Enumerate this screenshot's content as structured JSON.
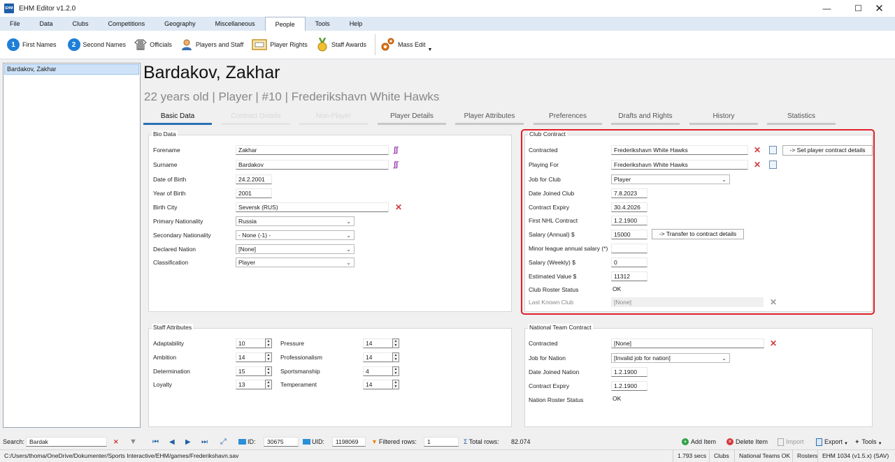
{
  "window": {
    "title": "EHM Editor v1.2.0",
    "app_icon_text": "EHM"
  },
  "menu": [
    "File",
    "Data",
    "Clubs",
    "Competitions",
    "Geography",
    "Miscellaneous",
    "People",
    "Tools",
    "Help"
  ],
  "menu_active": "People",
  "toolbar": {
    "first_names": "First Names",
    "first_names_num": "1",
    "second_names": "Second Names",
    "second_names_num": "2",
    "officials": "Officials",
    "players_staff": "Players and Staff",
    "player_rights": "Player Rights",
    "staff_awards": "Staff Awards",
    "mass_edit": "Mass Edit"
  },
  "list": {
    "items": [
      "Bardakov, Zakhar"
    ]
  },
  "player": {
    "name": "Bardakov, Zakhar",
    "subtitle": "22 years old | Player | #10 | Frederikshavn White Hawks"
  },
  "tabs": [
    "Basic Data",
    "Contract Details",
    "Non-Player",
    "Player Details",
    "Player Attributes",
    "Preferences",
    "Drafts and Rights",
    "History",
    "Statistics"
  ],
  "bio": {
    "title": "Bio Data",
    "forename_label": "Forename",
    "forename": "Zakhar",
    "surname_label": "Surname",
    "surname": "Bardakov",
    "dob_label": "Date of Birth",
    "dob": "24.2.2001",
    "yob_label": "Year of Birth",
    "yob": "2001",
    "city_label": "Birth City",
    "city": "Seversk (RUS)",
    "primary_nat_label": "Primary Nationality",
    "primary_nat": "Russia",
    "secondary_nat_label": "Secondary Nationality",
    "secondary_nat": "- None (-1) -",
    "declared_label": "Declared Nation",
    "declared": "[None]",
    "class_label": "Classification",
    "class": "Player"
  },
  "club_contract": {
    "title": "Club Contract",
    "contracted_label": "Contracted",
    "contracted": "Frederikshavn White Hawks",
    "set_details_btn": "-> Set player contract details",
    "playing_for_label": "Playing For",
    "playing_for": "Frederikshavn White Hawks",
    "job_label": "Job for Club",
    "job": "Player",
    "joined_label": "Date Joined Club",
    "joined": "7.8.2023",
    "expiry_label": "Contract Expiry",
    "expiry": "30.4.2026",
    "first_nhl_label": "First NHL Contract",
    "first_nhl": "1.2.1900",
    "salary_label": "Salary (Annual) $",
    "salary": "15000",
    "transfer_btn": "-> Transfer to contract details",
    "minor_label": "Minor league annual salary (*)",
    "minor": "",
    "weekly_label": "Salary (Weekly) $",
    "weekly": "0",
    "est_label": "Estimated Value $",
    "est": "11312",
    "roster_label": "Club Roster Status",
    "roster": "OK",
    "last_club_label": "Last Known Club",
    "last_club": "[None]"
  },
  "staff": {
    "title": "Staff Attributes",
    "adaptability_label": "Adaptability",
    "adaptability": "10",
    "ambition_label": "Ambition",
    "ambition": "14",
    "determination_label": "Determination",
    "determination": "15",
    "loyalty_label": "Loyalty",
    "loyalty": "13",
    "pressure_label": "Pressure",
    "pressure": "14",
    "professionalism_label": "Professionalism",
    "professionalism": "14",
    "sportsmanship_label": "Sportsmanship",
    "sportsmanship": "4",
    "temperament_label": "Temperament",
    "temperament": "14"
  },
  "national": {
    "title": "National Team Contract",
    "contracted_label": "Contracted",
    "contracted": "[None]",
    "job_label": "Job for Nation",
    "job": "[Invalid job for nation]",
    "joined_label": "Date Joined Nation",
    "joined": "1.2.1900",
    "expiry_label": "Contract Expiry",
    "expiry": "1.2.1900",
    "roster_label": "Nation Roster Status",
    "roster": "OK"
  },
  "navbar": {
    "search_label": "Search:",
    "search": "Bardak",
    "id_label": "ID:",
    "id": "30675",
    "uid_label": "UID:",
    "uid": "1198069",
    "filtered_label": "Filtered rows:",
    "filtered": "1",
    "total_label": "Total rows:",
    "total": "82.074",
    "add": "Add Item",
    "delete": "Delete Item",
    "import": "Import",
    "export": "Export",
    "tools": "Tools"
  },
  "status": {
    "path": "C:/Users/thoma/OneDrive/Dokumenter/Sports Interactive/EHM/games/Frederikshavn.sav",
    "time": "1.793 secs",
    "clubs": "Clubs",
    "national": "National Teams OK",
    "rosters": "Rosters",
    "version": "EHM 1034 (v1.5.x) (SAV)"
  },
  "colors": {
    "accent": "#2b6fb6",
    "highlight": "#e0202a",
    "delete_red": "#d23a3a"
  }
}
